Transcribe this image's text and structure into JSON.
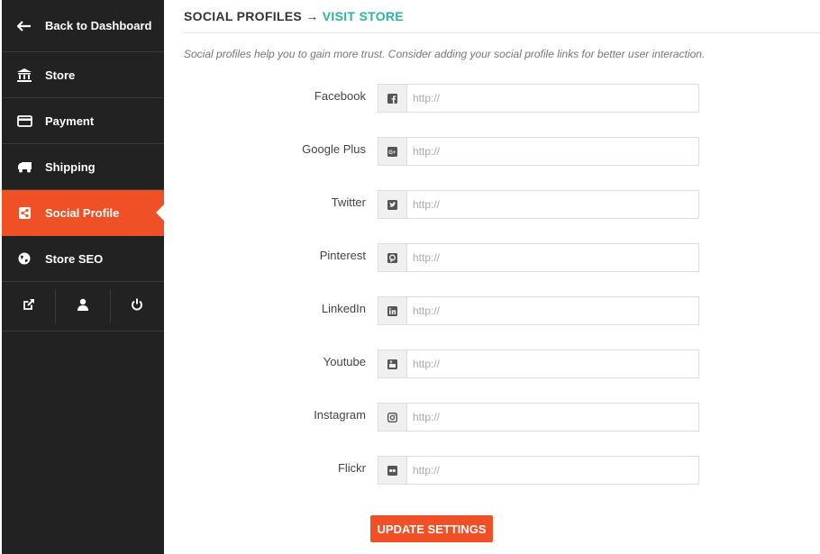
{
  "sidebar": {
    "items": [
      {
        "label": "Back to Dashboard",
        "icon": "arrow-left-icon"
      },
      {
        "label": "Store",
        "icon": "bank-icon"
      },
      {
        "label": "Payment",
        "icon": "credit-card-icon"
      },
      {
        "label": "Shipping",
        "icon": "truck-icon"
      },
      {
        "label": "Social Profile",
        "icon": "share-icon",
        "active": true
      },
      {
        "label": "Store SEO",
        "icon": "globe-icon"
      }
    ],
    "tools": [
      {
        "icon": "external-link-icon"
      },
      {
        "icon": "user-icon"
      },
      {
        "icon": "power-icon"
      }
    ],
    "active_color": "#f05025",
    "bg_color": "#222222"
  },
  "main": {
    "title": "SOCIAL PROFILES",
    "arrow": "→",
    "visit_store": "VISIT STORE",
    "link_color": "#2bb3a3",
    "intro": "Social profiles help you to gain more trust. Consider adding your social profile links for better user interaction.",
    "fields": [
      {
        "label": "Facebook",
        "icon": "facebook-icon",
        "value": "",
        "placeholder": "http://"
      },
      {
        "label": "Google Plus",
        "icon": "google-plus-icon",
        "value": "",
        "placeholder": "http://"
      },
      {
        "label": "Twitter",
        "icon": "twitter-icon",
        "value": "",
        "placeholder": "http://"
      },
      {
        "label": "Pinterest",
        "icon": "pinterest-icon",
        "value": "",
        "placeholder": "http://"
      },
      {
        "label": "LinkedIn",
        "icon": "linkedin-icon",
        "value": "",
        "placeholder": "http://"
      },
      {
        "label": "Youtube",
        "icon": "youtube-icon",
        "value": "",
        "placeholder": "http://"
      },
      {
        "label": "Instagram",
        "icon": "instagram-icon",
        "value": "",
        "placeholder": "http://"
      },
      {
        "label": "Flickr",
        "icon": "flickr-icon",
        "value": "",
        "placeholder": "http://"
      }
    ],
    "update_button": "UPDATE SETTINGS",
    "button_color": "#f05025"
  }
}
